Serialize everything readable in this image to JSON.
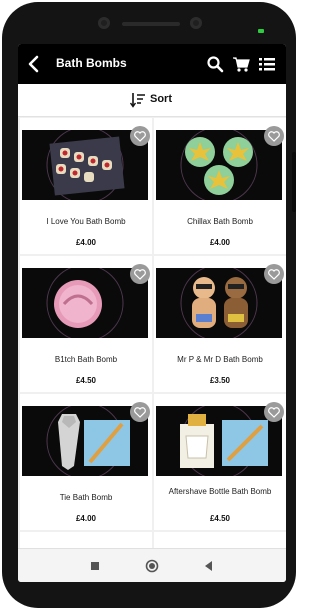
{
  "header": {
    "title": "Bath Bombs"
  },
  "sort": {
    "label": "Sort"
  },
  "products": [
    {
      "name": "I Love You  Bath Bomb",
      "price": "£4.00"
    },
    {
      "name": "Chillax Bath Bomb",
      "price": "£4.00"
    },
    {
      "name": "B1tch Bath Bomb",
      "price": "£4.50"
    },
    {
      "name": "Mr P & Mr D Bath Bomb",
      "price": "£3.50"
    },
    {
      "name": "Tie Bath Bomb",
      "price": "£4.00"
    },
    {
      "name": "Aftershave  Bottle Bath Bomb",
      "price": "£4.50"
    }
  ],
  "colors": {
    "appbar": "#000000",
    "screen_bg": "#f0f0f0",
    "fav_bg": "#9a9a9a"
  }
}
